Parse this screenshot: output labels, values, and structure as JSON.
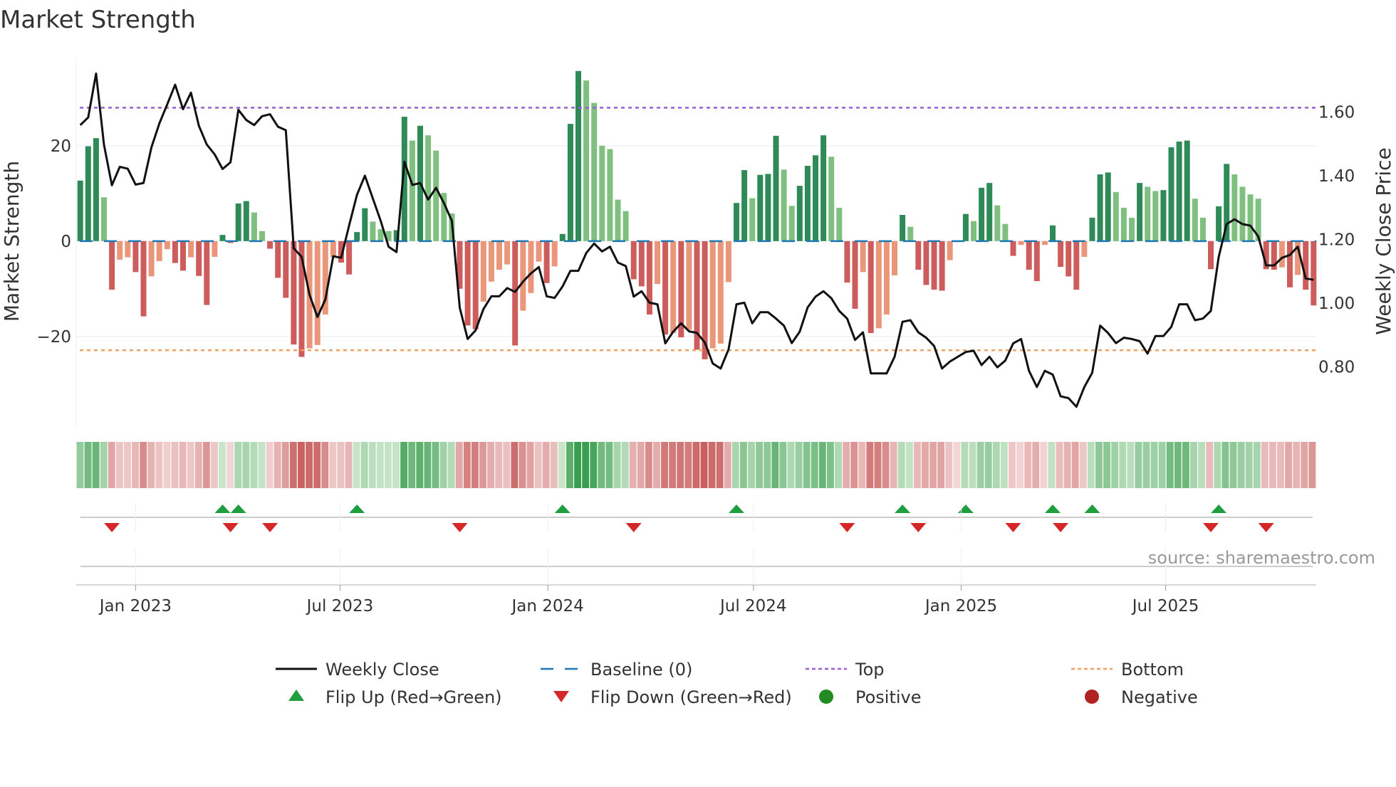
{
  "chart_data": {
    "type": "bar",
    "title": "Market Strength",
    "ylabel": "Market Strength",
    "y2label": "Weekly Close Price",
    "ylim": [
      -38.7,
      38.5
    ],
    "y2lim": [
      0.615,
      1.771
    ],
    "yticks": [
      {
        "v": 20,
        "label": "20"
      },
      {
        "v": 0,
        "label": "0"
      },
      {
        "v": -20,
        "label": "−20"
      }
    ],
    "y2ticks": [
      {
        "v": 1.6,
        "label": "1.60"
      },
      {
        "v": 1.4,
        "label": "1.40"
      },
      {
        "v": 1.2,
        "label": "1.20"
      },
      {
        "v": 1.0,
        "label": "1.00"
      },
      {
        "v": 0.8,
        "label": "0.80"
      }
    ],
    "xticks": [
      {
        "date": "2023-01-01",
        "label": "Jan 2023"
      },
      {
        "date": "2023-07-01",
        "label": "Jul 2023"
      },
      {
        "date": "2024-01-01",
        "label": "Jan 2024"
      },
      {
        "date": "2024-07-01",
        "label": "Jul 2024"
      },
      {
        "date": "2025-01-01",
        "label": "Jan 2025"
      },
      {
        "date": "2025-07-01",
        "label": "Jul 2025"
      }
    ],
    "start_date": "2022-11-13",
    "interval": "weekly",
    "top_level": 28.0,
    "bottom_level": -22.9,
    "strength": [
      12.7,
      19.9,
      21.6,
      9.2,
      -10.2,
      -3.9,
      -3.4,
      -6.5,
      -15.8,
      -7.4,
      -4.2,
      -1.7,
      -4.6,
      -6.2,
      -3.4,
      -7.3,
      -13.4,
      -3.3,
      1.3,
      -0.4,
      7.9,
      8.4,
      6.0,
      2.1,
      -1.6,
      -7.7,
      -11.9,
      -21.7,
      -24.3,
      -22.5,
      -21.8,
      -15.4,
      -3.4,
      -4.5,
      -7.0,
      1.9,
      6.9,
      4.1,
      2.5,
      2.1,
      2.3,
      26.1,
      21.1,
      24.2,
      22.2,
      19.0,
      10.1,
      5.8,
      -10.0,
      -17.7,
      -18.5,
      -12.7,
      -8.5,
      -6.0,
      -4.9,
      -21.9,
      -14.6,
      -10.9,
      -4.3,
      -8.8,
      -5.3,
      1.5,
      24.6,
      35.7,
      33.7,
      29.0,
      20.0,
      19.3,
      8.7,
      6.3,
      -8.0,
      -9.5,
      -15.4,
      -9.0,
      -19.6,
      -19.3,
      -20.2,
      -18.6,
      -22.8,
      -24.8,
      -22.5,
      -21.5,
      -8.6,
      8.0,
      14.9,
      9.0,
      13.9,
      14.1,
      22.1,
      15.0,
      7.4,
      11.6,
      15.8,
      18.0,
      22.2,
      17.7,
      7.0,
      -8.7,
      -14.2,
      -6.5,
      -19.3,
      -18.3,
      -15.4,
      -7.2,
      5.5,
      3.0,
      -6.0,
      -9.2,
      -10.2,
      -10.4,
      -4.0,
      -0.2,
      5.7,
      4.2,
      11.2,
      12.2,
      7.5,
      3.6,
      -3.1,
      -0.8,
      -6.0,
      -8.4,
      -0.8,
      3.3,
      -5.4,
      -7.4,
      -10.2,
      -3.3,
      4.9,
      14.0,
      14.4,
      10.3,
      7.0,
      4.9,
      12.2,
      11.4,
      10.5,
      10.7,
      19.7,
      20.9,
      21.1,
      8.9,
      4.9,
      -5.9,
      7.3,
      16.2,
      14.0,
      11.4,
      9.8,
      8.9,
      -5.9,
      -6.0,
      -5.5,
      -9.7,
      -7.1,
      -10.2,
      -13.5
    ],
    "close": [
      1.559,
      1.583,
      1.721,
      1.497,
      1.37,
      1.428,
      1.422,
      1.372,
      1.377,
      1.489,
      1.564,
      1.624,
      1.686,
      1.609,
      1.661,
      1.557,
      1.498,
      1.467,
      1.421,
      1.442,
      1.607,
      1.575,
      1.559,
      1.587,
      1.593,
      1.554,
      1.543,
      1.172,
      1.145,
      1.026,
      0.956,
      1.011,
      1.147,
      1.142,
      1.243,
      1.34,
      1.4,
      1.329,
      1.258,
      1.177,
      1.16,
      1.444,
      1.371,
      1.377,
      1.325,
      1.362,
      1.314,
      1.258,
      0.985,
      0.887,
      0.914,
      0.981,
      1.021,
      1.021,
      1.047,
      1.035,
      1.067,
      1.093,
      1.113,
      1.021,
      1.016,
      1.052,
      1.101,
      1.101,
      1.157,
      1.187,
      1.162,
      1.177,
      1.127,
      1.116,
      1.02,
      1.037,
      1.001,
      0.996,
      0.873,
      0.91,
      0.936,
      0.911,
      0.906,
      0.876,
      0.81,
      0.794,
      0.854,
      0.996,
      1.001,
      0.936,
      0.971,
      0.971,
      0.951,
      0.929,
      0.874,
      0.91,
      0.986,
      1.02,
      1.037,
      1.015,
      0.975,
      0.951,
      0.884,
      0.908,
      0.779,
      0.779,
      0.779,
      0.831,
      0.941,
      0.946,
      0.908,
      0.891,
      0.865,
      0.794,
      0.816,
      0.831,
      0.846,
      0.85,
      0.805,
      0.831,
      0.798,
      0.819,
      0.873,
      0.887,
      0.787,
      0.736,
      0.787,
      0.775,
      0.707,
      0.701,
      0.674,
      0.736,
      0.781,
      0.929,
      0.906,
      0.874,
      0.891,
      0.887,
      0.88,
      0.841,
      0.896,
      0.896,
      0.925,
      0.996,
      0.996,
      0.946,
      0.951,
      0.975,
      1.145,
      1.248,
      1.263,
      1.248,
      1.243,
      1.209,
      1.118,
      1.118,
      1.142,
      1.151,
      1.177,
      1.077,
      1.073
    ],
    "legend": [
      {
        "key": "close",
        "label": "Weekly Close"
      },
      {
        "key": "baseline",
        "label": "Baseline (0)"
      },
      {
        "key": "top",
        "label": "Top"
      },
      {
        "key": "bottom",
        "label": "Bottom"
      },
      {
        "key": "flipup",
        "label": "Flip Up (Red→Green)"
      },
      {
        "key": "flipdown",
        "label": "Flip Down (Green→Red)"
      },
      {
        "key": "positive",
        "label": "Positive"
      },
      {
        "key": "negative",
        "label": "Negative"
      }
    ],
    "legend_placement": "bottom",
    "source": "source: sharemaestro.com",
    "colors": {
      "pos_rising": "#2e8b57",
      "pos_falling": "#7fbf7f",
      "neg_falling": "#cd5c5c",
      "neg_rising": "#e9967a",
      "close": "#111111",
      "baseline": "#1f77b4",
      "top": "#9a5fd6",
      "bottom": "#f0a060",
      "flip_up": "#1e9e3e",
      "flip_down": "#d62728",
      "positive": "#228b22",
      "negative": "#b22222"
    }
  }
}
